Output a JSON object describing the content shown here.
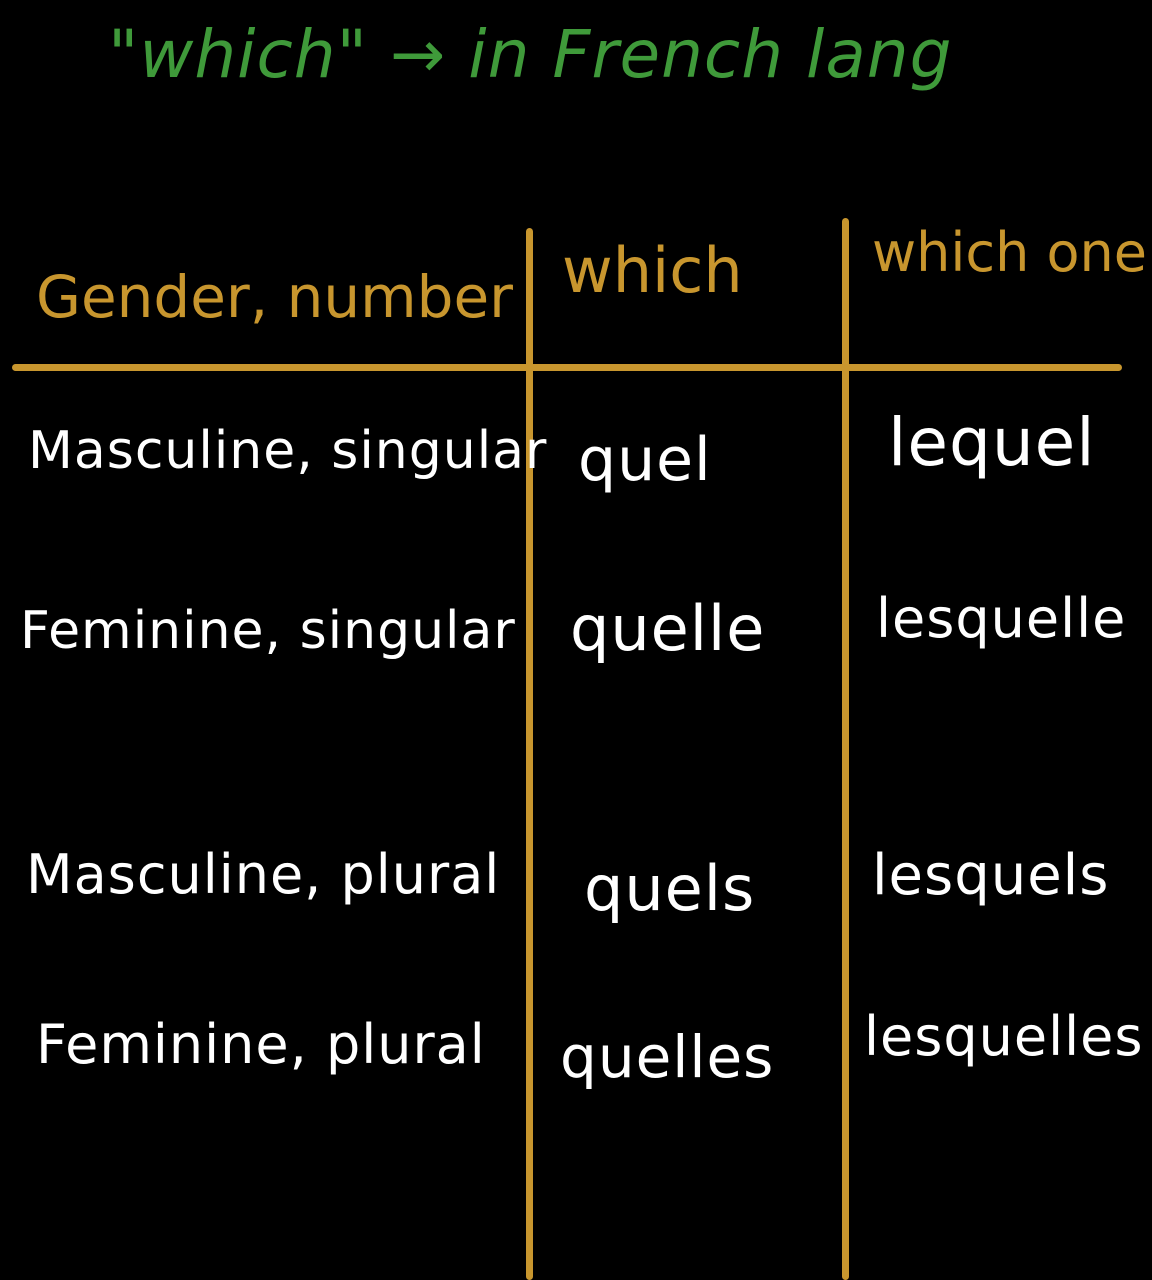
{
  "colors": {
    "background": "#000000",
    "title": "#3f9a3a",
    "header": "#c8962e",
    "lines": "#c8962e",
    "body": "#ffffff"
  },
  "title": "\"which\" → in French lang",
  "table": {
    "headers": [
      "Gender, number",
      "which",
      "which one"
    ],
    "rows": [
      [
        "Masculine, singular",
        "quel",
        "lequel"
      ],
      [
        "Feminine, singular",
        "quelle",
        "lesquelle"
      ],
      [
        "Masculine, plural",
        "quels",
        "lesquels"
      ],
      [
        "Feminine, plural",
        "quelles",
        "lesquelles"
      ]
    ]
  }
}
